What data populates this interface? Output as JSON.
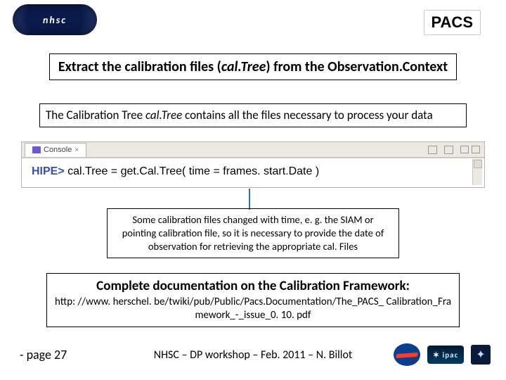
{
  "header": {
    "nhsc": "nhsc",
    "pacs": "PACS"
  },
  "title": {
    "pre": "Extract the calibration files (",
    "ital": "cal.Tree",
    "post": ") from the Observation.Context"
  },
  "desc": {
    "pre": "The Calibration Tree ",
    "ital": "cal.Tree",
    "post": " contains all the files necessary to process your data"
  },
  "console": {
    "tab_label": "Console",
    "close": "×",
    "prompt": "HIPE>",
    "command": " cal.Tree = get.Cal.Tree( time = frames. start.Date )"
  },
  "note": "Some calibration files changed with time, e. g. the SIAM or pointing calibration file, so it is necessary to provide the date of observation for retrieving the appropriate cal. Files",
  "doc": {
    "title": "Complete documentation on the Calibration Framework:",
    "url": "http: //www. herschel. be/twiki/pub/Public/Pacs.Documentation/The_PACS_ Calibration_Framework_-_issue_0. 10. pdf"
  },
  "footer": {
    "page": "- page 27",
    "credit": "NHSC – DP workshop – Feb. 2011 – N. Billot",
    "ipac": "ipac"
  }
}
